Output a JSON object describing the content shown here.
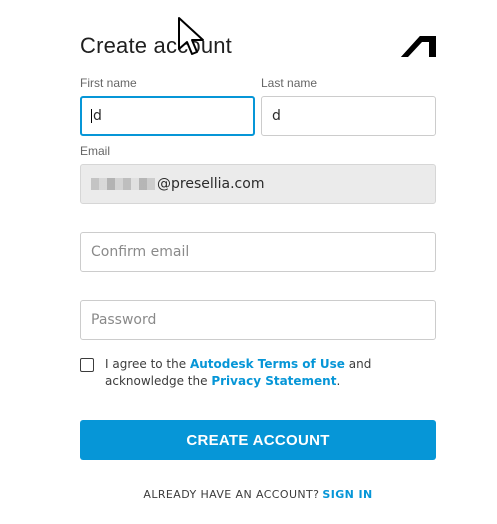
{
  "form": {
    "title": "Create account",
    "first_name": {
      "label": "First name",
      "value": "d"
    },
    "last_name": {
      "label": "Last name",
      "value": "d"
    },
    "email": {
      "label": "Email",
      "value_suffix": "@presellia.com"
    },
    "confirm_email": {
      "placeholder": "Confirm email"
    },
    "password": {
      "placeholder": "Password"
    },
    "agree": {
      "prefix": "I agree to the ",
      "terms_link": "Autodesk Terms of Use",
      "middle": " and acknowledge the ",
      "privacy_link": "Privacy Statement",
      "suffix": "."
    },
    "submit_label": "CREATE ACCOUNT",
    "signin_prompt": "ALREADY HAVE AN ACCOUNT?",
    "signin_link": "SIGN IN"
  },
  "colors": {
    "accent": "#0696d7",
    "text": "#3c3c3c",
    "readonly_bg": "#ebebeb"
  },
  "icons": {
    "logo": "autodesk-logo-icon",
    "pointer": "mouse-cursor-icon"
  }
}
